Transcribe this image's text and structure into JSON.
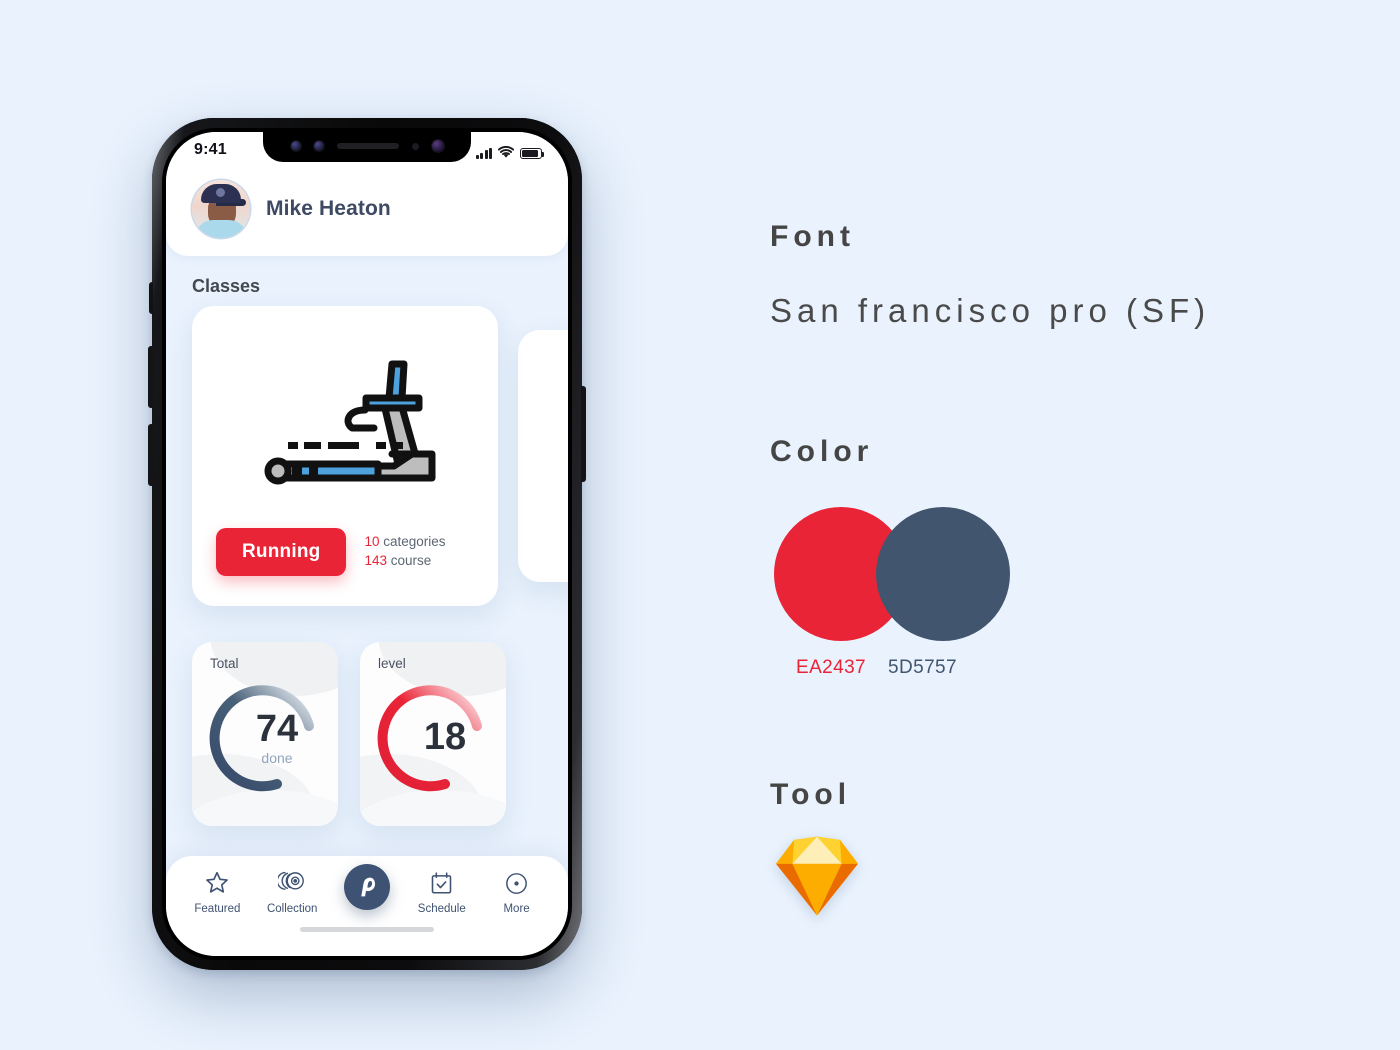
{
  "background_color": "#e9f2fd",
  "phone": {
    "status_bar": {
      "time": "9:41",
      "signal_icon": "cellular-bars-icon",
      "wifi_icon": "wifi-icon",
      "battery_icon": "battery-icon"
    },
    "header": {
      "avatar_name": "user-avatar",
      "user_name": "Mike Heaton"
    },
    "content": {
      "section_title": "Classes",
      "class_card": {
        "illustration": "treadmill-icon",
        "pill_label": "Running",
        "stat_categories_value": "10",
        "stat_categories_label": " categories",
        "stat_course_value": "143",
        "stat_course_label": " course"
      },
      "metrics": [
        {
          "label": "Total",
          "value": "74",
          "sub": "done",
          "percent": 74,
          "color_from": "#36496a",
          "color_to": "#dde7f2"
        },
        {
          "label": "level",
          "value": "18",
          "sub": "",
          "percent": 74,
          "color_from": "#e01f35",
          "color_to": "#fbdde0"
        }
      ]
    },
    "tabbar": {
      "items": [
        {
          "label": "Featured",
          "icon": "star-icon"
        },
        {
          "label": "Collection",
          "icon": "discs-icon"
        },
        {
          "label": "",
          "icon": "peloton-logo-icon"
        },
        {
          "label": "Schedule",
          "icon": "calendar-check-icon"
        },
        {
          "label": "More",
          "icon": "target-dot-icon"
        }
      ]
    }
  },
  "panel": {
    "font": {
      "heading": "Font",
      "value": "San francisco pro (SF)"
    },
    "color": {
      "heading": "Color",
      "swatches": [
        {
          "name": "primary-red",
          "hex": "EA2437",
          "css": "#ea2437"
        },
        {
          "name": "primary-blue",
          "hex": "5D5757",
          "css": "#42556f"
        }
      ]
    },
    "tool": {
      "heading": "Tool",
      "icon": "sketch-logo-icon"
    }
  }
}
